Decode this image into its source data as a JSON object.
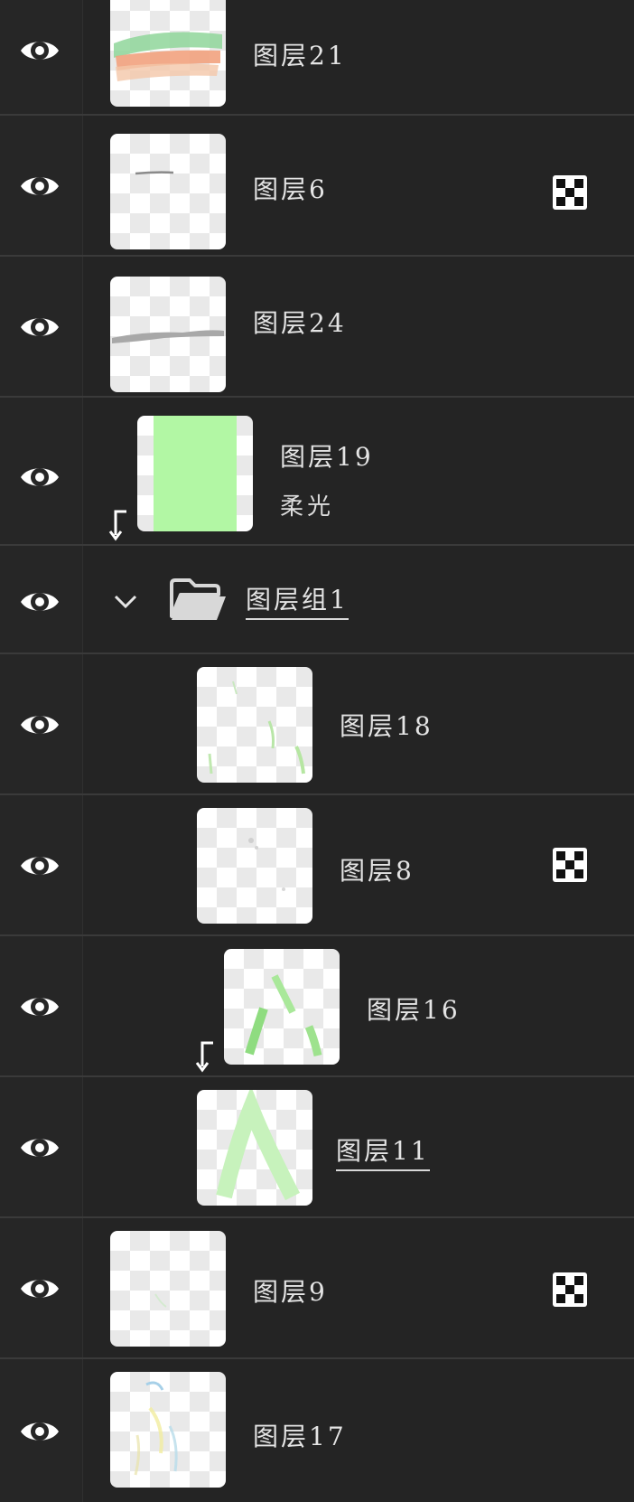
{
  "layers": [
    {
      "id": "21",
      "name": "图层21",
      "mask": false
    },
    {
      "id": "6",
      "name": "图层6",
      "mask": true
    },
    {
      "id": "24",
      "name": "图层24",
      "mask": false
    },
    {
      "id": "19",
      "name": "图层19",
      "blend_mode": "柔光",
      "clipped": true
    },
    {
      "id": "group1",
      "name": "图层组1",
      "type": "group",
      "expanded": true
    },
    {
      "id": "18",
      "name": "图层18",
      "mask": false
    },
    {
      "id": "8",
      "name": "图层8",
      "mask": true
    },
    {
      "id": "16",
      "name": "图层16",
      "clipped": true
    },
    {
      "id": "11",
      "name": "图层11",
      "selected_underline": true
    },
    {
      "id": "9",
      "name": "图层9",
      "mask": true
    },
    {
      "id": "17",
      "name": "图层17",
      "mask": false
    }
  ],
  "icons": {
    "visibility": "eye-icon",
    "mask": "checkerboard-mask-icon",
    "clipping": "clip-arrow-icon",
    "group_toggle": "chevron-down-icon",
    "group": "folder-open-icon"
  },
  "colors": {
    "panel_bg": "#242424",
    "divider": "#3a3a3a",
    "text": "#e4e4e4",
    "soft_light_green": "#b2f7a4"
  }
}
